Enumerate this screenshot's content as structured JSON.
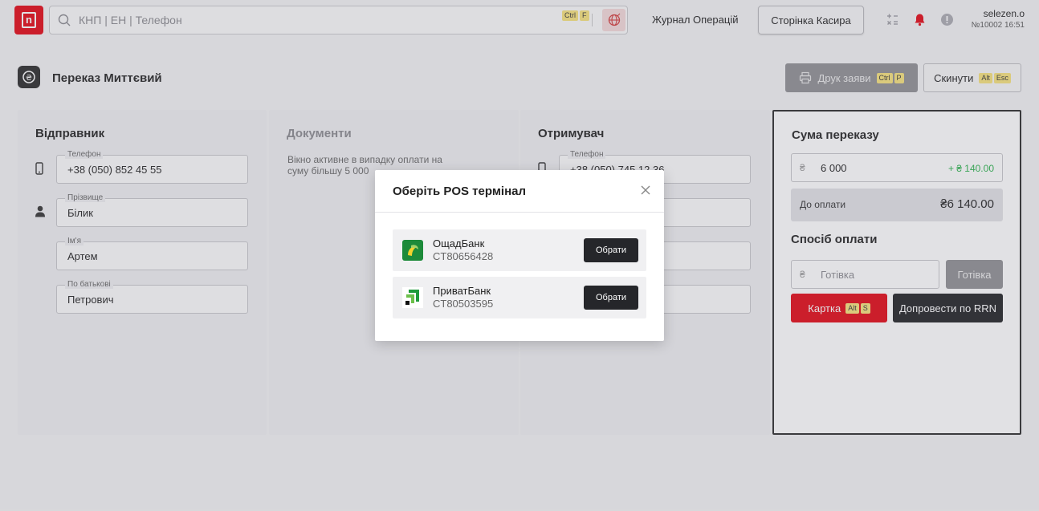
{
  "topbar": {
    "search_placeholder": "КНП | ЕН | Телефон",
    "hotkey": [
      "Ctrl",
      "F"
    ],
    "operations_link": "Журнал Операцій",
    "cashier_button": "Сторінка Касира",
    "user_name": "selezen.o",
    "user_sub": "№10002 16:51"
  },
  "page": {
    "title": "Переказ Миттєвий",
    "print_button": "Друк заяви",
    "print_hotkey": [
      "Ctrl",
      "P"
    ],
    "reset_button": "Скинути",
    "reset_hotkey": [
      "Alt",
      "Esc"
    ]
  },
  "sender": {
    "title": "Відправник",
    "fields": [
      {
        "label": "Телефон",
        "value": "+38 (050) 852 45 55"
      },
      {
        "label": "Прізвище",
        "value": "Білик"
      },
      {
        "label": "Ім'я",
        "value": "Артем"
      },
      {
        "label": "По батькові",
        "value": "Петрович"
      }
    ]
  },
  "documents": {
    "title": "Документи",
    "note": "Вікно активне в випадку оплати на суму більшу 5 000"
  },
  "receiver": {
    "title": "Отримувач",
    "fields": [
      {
        "label": "Телефон",
        "value": "+38 (050) 745 12 36"
      }
    ]
  },
  "summary": {
    "title": "Сума переказу",
    "currency": "₴",
    "amount": "6 000",
    "fee": "+ ₴ 140.00",
    "to_pay_label": "До оплати",
    "to_pay_value": "₴6 140.00",
    "payment_title": "Спосіб оплати",
    "cash_placeholder": "Готівка",
    "cash_button": "Готівка",
    "card_button": "Картка",
    "card_hotkey": [
      "Alt",
      "S"
    ],
    "rrn_button": "Допровести по RRN"
  },
  "modal": {
    "title": "Оберіть POS термінал",
    "terminals": [
      {
        "bank": "ОщадБанк",
        "id": "CT80656428",
        "button": "Обрати",
        "icon": "oschadbank-logo"
      },
      {
        "bank": "ПриватБанк",
        "id": "CT80503595",
        "button": "Обрати",
        "icon": "privatbank-logo"
      }
    ]
  },
  "colors": {
    "brand_red": "#e30613",
    "dark": "#1f2023",
    "fee_green": "#2bb24c",
    "hotkey_yellow": "#f6e27a"
  }
}
